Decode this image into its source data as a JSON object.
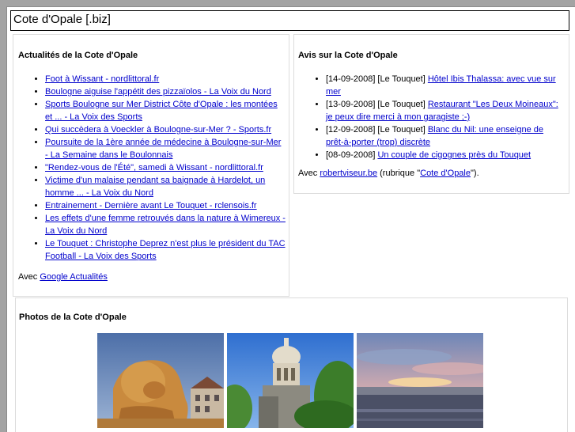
{
  "header": {
    "title": "Cote d'Opale [.biz]"
  },
  "news": {
    "heading": "Actualités de la Cote d'Opale",
    "items": [
      "Foot à Wissant - nordlittoral.fr",
      "Boulogne aiguise l'appétit des pizzaïolos - La Voix du Nord",
      "Sports Boulogne sur Mer District Côte d'Opale : les montées et ... - La Voix des Sports",
      "Qui succèdera à Voeckler à Boulogne-sur-Mer ? - Sports.fr",
      "Poursuite de la 1ère année de médecine à Boulogne-sur-Mer - La Semaine dans le Boulonnais",
      "\"Rendez-vous de l'Été\", samedi à Wissant - nordlittoral.fr",
      "Victime d'un malaise pendant sa baignade à Hardelot, un homme ... - La Voix du Nord",
      "Entrainement - Dernière avant Le Touquet - rclensois.fr",
      "Les effets d'une femme retrouvés dans la nature à Wimereux - La Voix du Nord",
      "Le Touquet : Christophe Deprez n'est plus le président du TAC Football - La Voix des Sports"
    ],
    "footer_prefix": "Avec ",
    "footer_link": "Google Actualités"
  },
  "avis": {
    "heading": "Avis sur la Cote d'Opale",
    "items": [
      {
        "meta": "[14-09-2008] [Le Touquet] ",
        "link": "Hôtel Ibis Thalassa: avec vue sur mer"
      },
      {
        "meta": "[13-09-2008] [Le Touquet] ",
        "link": "Restaurant \"Les Deux Moineaux\": je peux dire merci à mon garagiste ;-)"
      },
      {
        "meta": "[12-09-2008] [Le Touquet] ",
        "link": "Blanc du Nil: une enseigne de prêt-à-porter (trop) discrète"
      },
      {
        "meta": "[08-09-2008] ",
        "link": "Un couple de cigognes près du Touquet"
      }
    ],
    "footer_prefix": "Avec ",
    "footer_link": "robertviseur.be",
    "footer_mid": " (rubrique \"",
    "footer_link2": "Cote d'Opale",
    "footer_end": "\")."
  },
  "photos": {
    "heading": "Photos de la Cote d'Opale"
  },
  "colors": {
    "link": "#0000cc",
    "frame": "#a3a3a3"
  }
}
